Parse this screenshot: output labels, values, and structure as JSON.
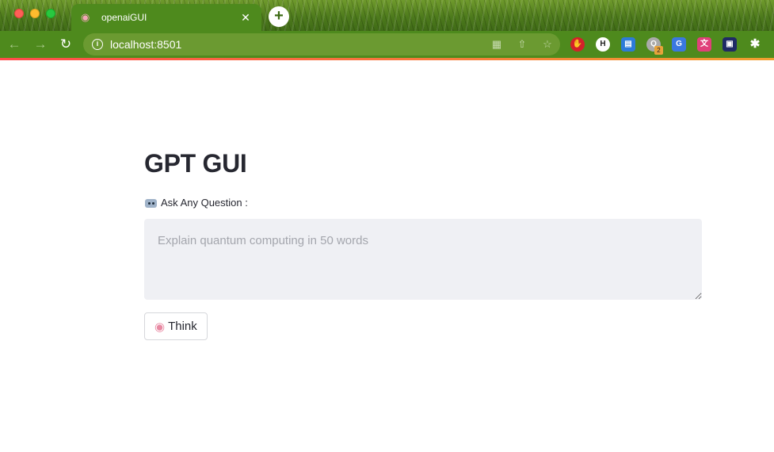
{
  "browser": {
    "tab": {
      "favicon": "brain-icon",
      "title": "openaiGUI",
      "close": "✕"
    },
    "new_tab": "+",
    "url": "localhost:8501",
    "extension_badge": "2",
    "colors": {
      "toolbar": "#4e8a1d",
      "omnibox": "#6b9a31",
      "accent_bar": "#ff4b4b"
    }
  },
  "page": {
    "title": "GPT GUI",
    "question_label": "Ask Any Question :",
    "question_label_icon": "robot-icon",
    "textarea_placeholder": "Explain quantum computing in 50 words",
    "submit_button": "Think",
    "submit_button_icon": "brain-icon"
  }
}
